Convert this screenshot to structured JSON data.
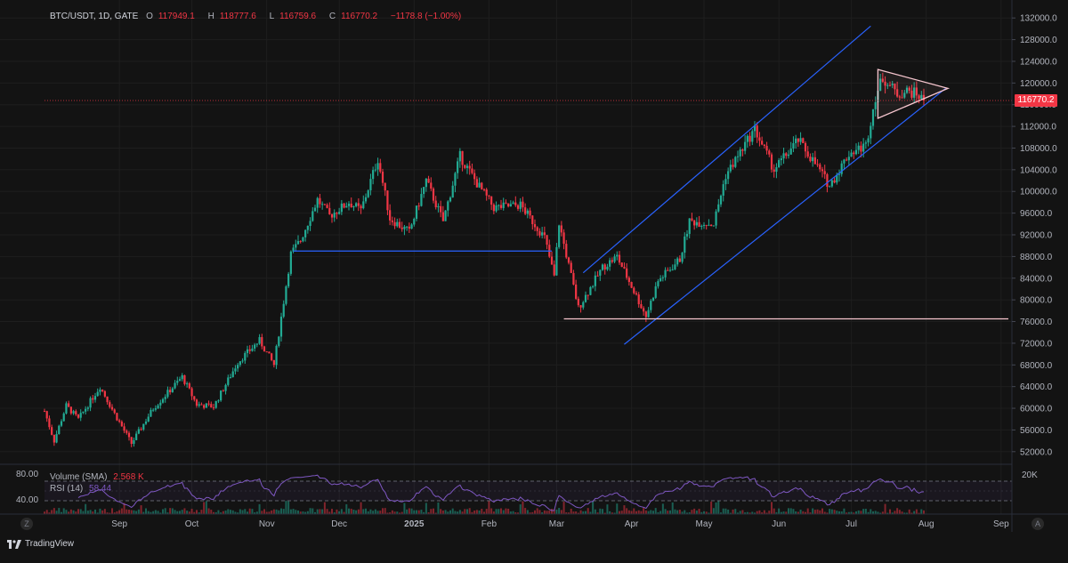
{
  "header": {
    "symbol": "BTC/USDT, 1D, GATE",
    "open_label": "O",
    "open": "117949.1",
    "high_label": "H",
    "high": "118777.6",
    "low_label": "L",
    "low": "116759.6",
    "close_label": "C",
    "close": "116770.2",
    "change": "−1178.8 (−1.00%)"
  },
  "price_tag": "116770.2",
  "indicators": {
    "volume_label": "Volume (SMA)",
    "volume_value": "2.568 K",
    "rsi_label": "RSI (14)",
    "rsi_value": "58.44",
    "rsi_level_80": "80.00",
    "rsi_level_40": "40.00",
    "volume_scale": "20K"
  },
  "branding": "TradingView",
  "buttons": {
    "zoom": "Z",
    "auto": "A"
  },
  "colors": {
    "background": "#131313",
    "up": "#22ab94",
    "down": "#f23645",
    "channel": "#2962ff",
    "support": "#f7c6cf",
    "rsi": "#7e57c2"
  },
  "chart_data": {
    "type": "candlestick",
    "symbol": "BTC/USDT",
    "timeframe": "1D",
    "exchange": "GATE",
    "ylim": [
      50000,
      134000
    ],
    "y_ticks": [
      52000,
      56000,
      60000,
      64000,
      68000,
      72000,
      76000,
      80000,
      84000,
      88000,
      92000,
      96000,
      100000,
      104000,
      108000,
      112000,
      116000,
      120000,
      124000,
      128000,
      132000
    ],
    "y_tick_labels": [
      "52000.0",
      "56000.0",
      "60000.0",
      "64000.0",
      "68000.0",
      "72000.0",
      "76000.0",
      "80000.0",
      "84000.0",
      "88000.0",
      "92000.0",
      "96000.0",
      "100000.0",
      "104000.0",
      "108000.0",
      "112000.0",
      "116000.0",
      "120000.0",
      "124000.0",
      "128000.0",
      "132000.0"
    ],
    "x_ticks": [
      "Sep",
      "Oct",
      "Nov",
      "Dec",
      "2025",
      "Feb",
      "Mar",
      "Apr",
      "May",
      "Jun",
      "Jul",
      "Aug",
      "Sep"
    ],
    "x_tick_dates": [
      "2024-09-01",
      "2024-10-01",
      "2024-11-01",
      "2024-12-01",
      "2025-01-01",
      "2025-02-01",
      "2025-03-01",
      "2025-04-01",
      "2025-05-01",
      "2025-06-01",
      "2025-07-01",
      "2025-08-01",
      "2025-09-01"
    ],
    "x_range": [
      "2024-08-01",
      "2025-09-04"
    ],
    "last_close": 116770.2,
    "close_path": [
      {
        "date": "2024-08-01",
        "close": 59500
      },
      {
        "date": "2024-08-05",
        "close": 54000
      },
      {
        "date": "2024-08-10",
        "close": 60500
      },
      {
        "date": "2024-08-15",
        "close": 58000
      },
      {
        "date": "2024-08-24",
        "close": 64000
      },
      {
        "date": "2024-08-30",
        "close": 59000
      },
      {
        "date": "2024-09-06",
        "close": 53500
      },
      {
        "date": "2024-09-15",
        "close": 60000
      },
      {
        "date": "2024-09-27",
        "close": 65800
      },
      {
        "date": "2024-10-03",
        "close": 60700
      },
      {
        "date": "2024-10-10",
        "close": 60300
      },
      {
        "date": "2024-10-20",
        "close": 68500
      },
      {
        "date": "2024-10-29",
        "close": 72500
      },
      {
        "date": "2024-11-04",
        "close": 68000
      },
      {
        "date": "2024-11-11",
        "close": 88500
      },
      {
        "date": "2024-11-15",
        "close": 91000
      },
      {
        "date": "2024-11-22",
        "close": 98500
      },
      {
        "date": "2024-11-27",
        "close": 95500
      },
      {
        "date": "2024-12-05",
        "close": 98000
      },
      {
        "date": "2024-12-10",
        "close": 96500
      },
      {
        "date": "2024-12-17",
        "close": 106000
      },
      {
        "date": "2024-12-22",
        "close": 95000
      },
      {
        "date": "2024-12-30",
        "close": 92500
      },
      {
        "date": "2025-01-06",
        "close": 102000
      },
      {
        "date": "2025-01-13",
        "close": 94500
      },
      {
        "date": "2025-01-20",
        "close": 106500
      },
      {
        "date": "2025-01-27",
        "close": 101500
      },
      {
        "date": "2025-02-03",
        "close": 97000
      },
      {
        "date": "2025-02-14",
        "close": 97500
      },
      {
        "date": "2025-02-24",
        "close": 91500
      },
      {
        "date": "2025-02-28",
        "close": 84300
      },
      {
        "date": "2025-03-02",
        "close": 94200
      },
      {
        "date": "2025-03-10",
        "close": 78500
      },
      {
        "date": "2025-03-20",
        "close": 86000
      },
      {
        "date": "2025-03-26",
        "close": 88000
      },
      {
        "date": "2025-04-01",
        "close": 82500
      },
      {
        "date": "2025-04-07",
        "close": 77000
      },
      {
        "date": "2025-04-12",
        "close": 83500
      },
      {
        "date": "2025-04-21",
        "close": 87500
      },
      {
        "date": "2025-04-25",
        "close": 94500
      },
      {
        "date": "2025-05-05",
        "close": 94000
      },
      {
        "date": "2025-05-10",
        "close": 103000
      },
      {
        "date": "2025-05-22",
        "close": 111500
      },
      {
        "date": "2025-05-30",
        "close": 104000
      },
      {
        "date": "2025-06-09",
        "close": 109500
      },
      {
        "date": "2025-06-17",
        "close": 104500
      },
      {
        "date": "2025-06-22",
        "close": 101000
      },
      {
        "date": "2025-06-30",
        "close": 107000
      },
      {
        "date": "2025-07-07",
        "close": 108500
      },
      {
        "date": "2025-07-11",
        "close": 117500
      },
      {
        "date": "2025-07-14",
        "close": 121000
      },
      {
        "date": "2025-07-20",
        "close": 118000
      },
      {
        "date": "2025-07-24",
        "close": 118500
      },
      {
        "date": "2025-07-28",
        "close": 118000
      },
      {
        "date": "2025-07-31",
        "close": 116770
      }
    ],
    "drawings": {
      "channel_upper": [
        [
          "2025-03-12",
          85000
        ],
        [
          "2025-07-09",
          130500
        ]
      ],
      "channel_lower": [
        [
          "2025-03-29",
          71800
        ],
        [
          "2025-08-09",
          119000
        ]
      ],
      "support_horizontal": [
        [
          "2025-03-04",
          76500
        ],
        [
          "2025-09-04",
          76500
        ]
      ],
      "resistance_horizontal": [
        [
          "2024-11-12",
          89000
        ],
        [
          "2025-02-27",
          89000
        ]
      ],
      "triangle": [
        [
          "2025-07-12",
          122500
        ],
        [
          "2025-07-12",
          113500
        ],
        [
          "2025-08-10",
          119000
        ]
      ]
    },
    "rsi": {
      "period": 14,
      "value": 58.44,
      "levels": [
        80,
        40
      ]
    },
    "volume": {
      "label": "Volume (SMA)",
      "value": "2.568 K"
    }
  }
}
